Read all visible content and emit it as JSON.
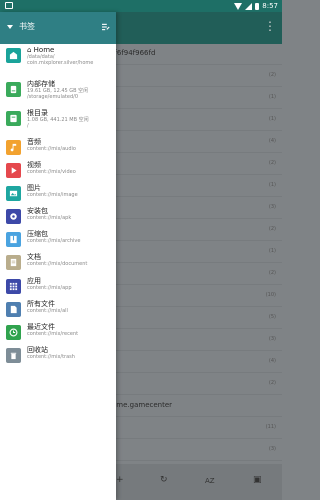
{
  "statusbar": {
    "time": "8:57"
  },
  "background": {
    "rows": [
      {
        "title": "ff6f94f966fd",
        "count": ""
      },
      {
        "title": "",
        "count": "(2)"
      },
      {
        "title": "",
        "count": "(1)"
      },
      {
        "title": "",
        "count": "(1)"
      },
      {
        "title": "",
        "count": "(4)"
      },
      {
        "title": "",
        "count": "(2)"
      },
      {
        "title": "",
        "count": "(1)"
      },
      {
        "title": "",
        "count": "(3)"
      },
      {
        "title": "",
        "count": "(2)"
      },
      {
        "title": "",
        "count": "(1)"
      },
      {
        "title": "",
        "count": "(2)"
      },
      {
        "title": "",
        "count": "(10)"
      },
      {
        "title": "",
        "count": "(5)"
      },
      {
        "title": "",
        "count": "(3)"
      },
      {
        "title": "",
        "count": "(4)"
      },
      {
        "title": "",
        "count": "(2)"
      },
      {
        "title": "eme.gamecenter",
        "count": ""
      },
      {
        "title": "",
        "count": "(11)"
      },
      {
        "title": "",
        "count": "(3)"
      }
    ],
    "bottom": {
      "add": "+",
      "refresh": "↻",
      "sort": "AZ",
      "view": "▣"
    }
  },
  "drawer": {
    "title": "书签",
    "items": [
      {
        "title": "⌂ Home",
        "sub": "/data/data/\ncoin.mixplorer.silver/home",
        "color": "#1aa39a",
        "icon": "home"
      },
      {
        "title": "内部存储",
        "sub": "19.61 GB, 12.45 GB 空闲\n/storage/emulated/0",
        "color": "#3aaa5b",
        "icon": "storage"
      },
      {
        "title": "根目录",
        "sub": "1.08 GB, 441.21 MB 空闲\n/",
        "color": "#3aaa5b",
        "icon": "root"
      },
      {
        "title": "音频",
        "sub": "content://mix/audio",
        "color": "#f2a22f",
        "icon": "music"
      },
      {
        "title": "视频",
        "sub": "content://mix/video",
        "color": "#e5484d",
        "icon": "video"
      },
      {
        "title": "图片",
        "sub": "content://mix/image",
        "color": "#1ea6a0",
        "icon": "image"
      },
      {
        "title": "安装包",
        "sub": "content://mix/apk",
        "color": "#3d49a8",
        "icon": "apk"
      },
      {
        "title": "压缩包",
        "sub": "content://mix/archive",
        "color": "#4aa3e0",
        "icon": "archive"
      },
      {
        "title": "文档",
        "sub": "content://mix/document",
        "color": "#b9ad8c",
        "icon": "document"
      },
      {
        "title": "应用",
        "sub": "content://mix/app",
        "color": "#3d49a8",
        "icon": "app"
      },
      {
        "title": "所有文件",
        "sub": "content://mix/all",
        "color": "#4f7fb0",
        "icon": "all"
      },
      {
        "title": "最近文件",
        "sub": "content://mix/recent",
        "color": "#30a34e",
        "icon": "recent"
      },
      {
        "title": "回收站",
        "sub": "content://mix/trash",
        "color": "#7e8d97",
        "icon": "trash"
      }
    ]
  }
}
